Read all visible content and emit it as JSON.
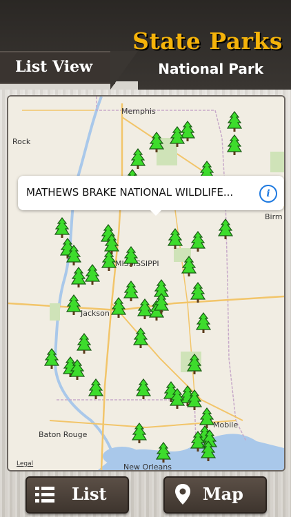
{
  "header": {
    "title": "State Parks",
    "subtitle": "National Park",
    "list_view_label": "List View"
  },
  "map": {
    "callout_text": "MATHEWS BRAKE NATIONAL WILDLIFE...",
    "labels": {
      "memphis": "Memphis",
      "rock": "Rock",
      "birm": "Birm",
      "mississippi": "MISSISSIPPI",
      "jackson": "Jackson",
      "mobile": "Mobile",
      "baton_rouge": "Baton Rouge",
      "new_orleans": "New Orleans",
      "legal": "Legal"
    },
    "marker_icon": "tree-icon",
    "marker_color": "#3ddc2c"
  },
  "footer": {
    "list_label": "List",
    "map_label": "Map"
  }
}
